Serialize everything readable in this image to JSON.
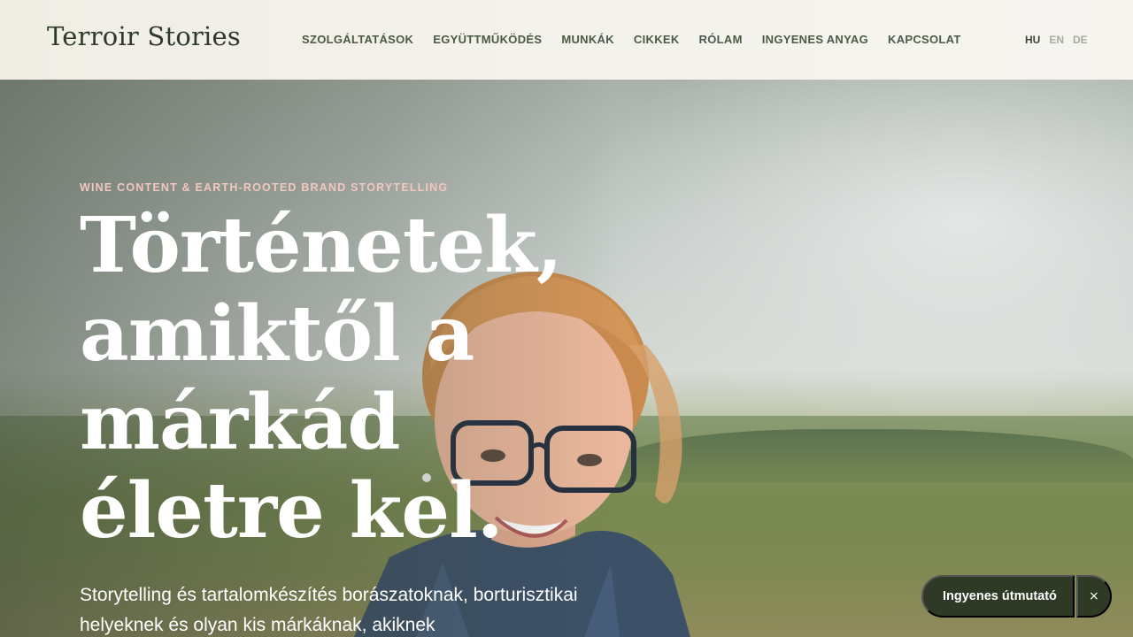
{
  "header": {
    "logo": "Terroir Stories",
    "nav": [
      {
        "label": "SZOLGÁLTATÁSOK"
      },
      {
        "label": "EGYÜTTMŰKÖDÉS"
      },
      {
        "label": "MUNKÁK"
      },
      {
        "label": "CIKKEK"
      },
      {
        "label": "RÓLAM"
      },
      {
        "label": "INGYENES ANYAG"
      },
      {
        "label": "KAPCSOLAT"
      }
    ],
    "languages": [
      {
        "label": "HU",
        "active": true
      },
      {
        "label": "EN",
        "active": false
      },
      {
        "label": "DE",
        "active": false
      }
    ]
  },
  "hero": {
    "eyebrow": "WINE CONTENT & EARTH-ROOTED BRAND STORYTELLING",
    "headline": "Történetek, amiktől a márkád életre kel.",
    "subtext": "Storytelling és tartalomkészítés borászatoknak, borturisztikai helyeknek és olyan kis márkáknak, akiknek"
  },
  "floating_cta": {
    "label": "Ingyenes útmutató",
    "close_icon": "close-icon",
    "close_glyph": "×"
  },
  "colors": {
    "brand_dark": "#2f3a26",
    "nav_text": "#4b5a45",
    "eyebrow": "#f2c7c0",
    "header_bg": "#f4f2ec"
  }
}
